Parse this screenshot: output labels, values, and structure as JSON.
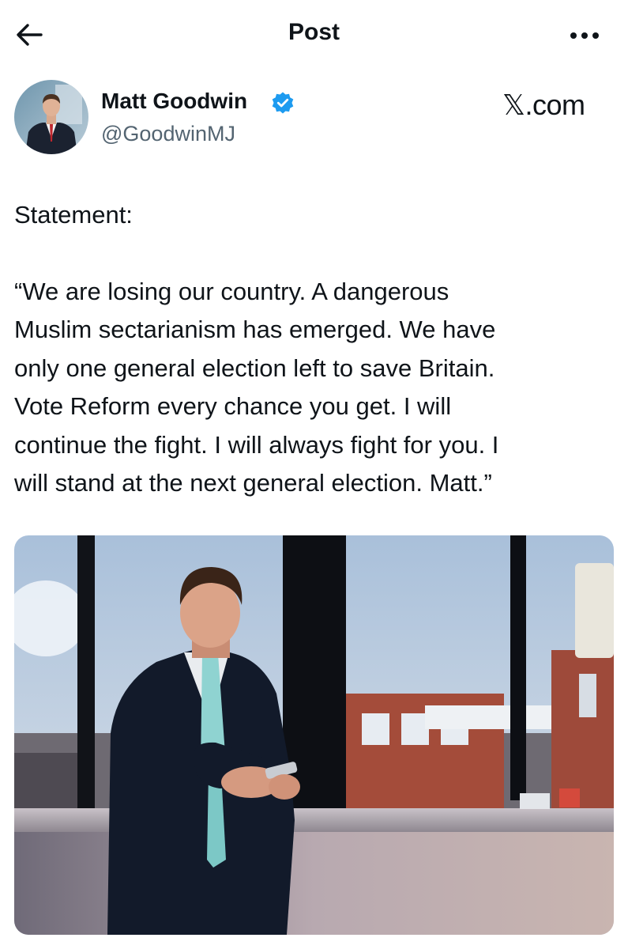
{
  "header": {
    "title": "Post",
    "back_icon": "arrow-left-icon",
    "more_icon": "more-horizontal-icon"
  },
  "author": {
    "name": "Matt Goodwin",
    "handle": "@GoodwinMJ",
    "verified_icon": "verified-badge-icon",
    "verified_color": "#1d9bf0"
  },
  "watermark": {
    "label": "𝕏.com"
  },
  "post": {
    "heading": "Statement:",
    "lines": [
      "“We are losing our country. A dangerous",
      "Muslim sectarianism has emerged. We have",
      "only one general election left to save Britain.",
      "Vote Reform every chance you get. I will",
      "continue the fight. I will always fight for you. I",
      "will stand at the next general election. Matt.”"
    ]
  },
  "colors": {
    "text_primary": "#0f1419",
    "text_secondary": "#536471",
    "accent": "#1d9bf0"
  }
}
